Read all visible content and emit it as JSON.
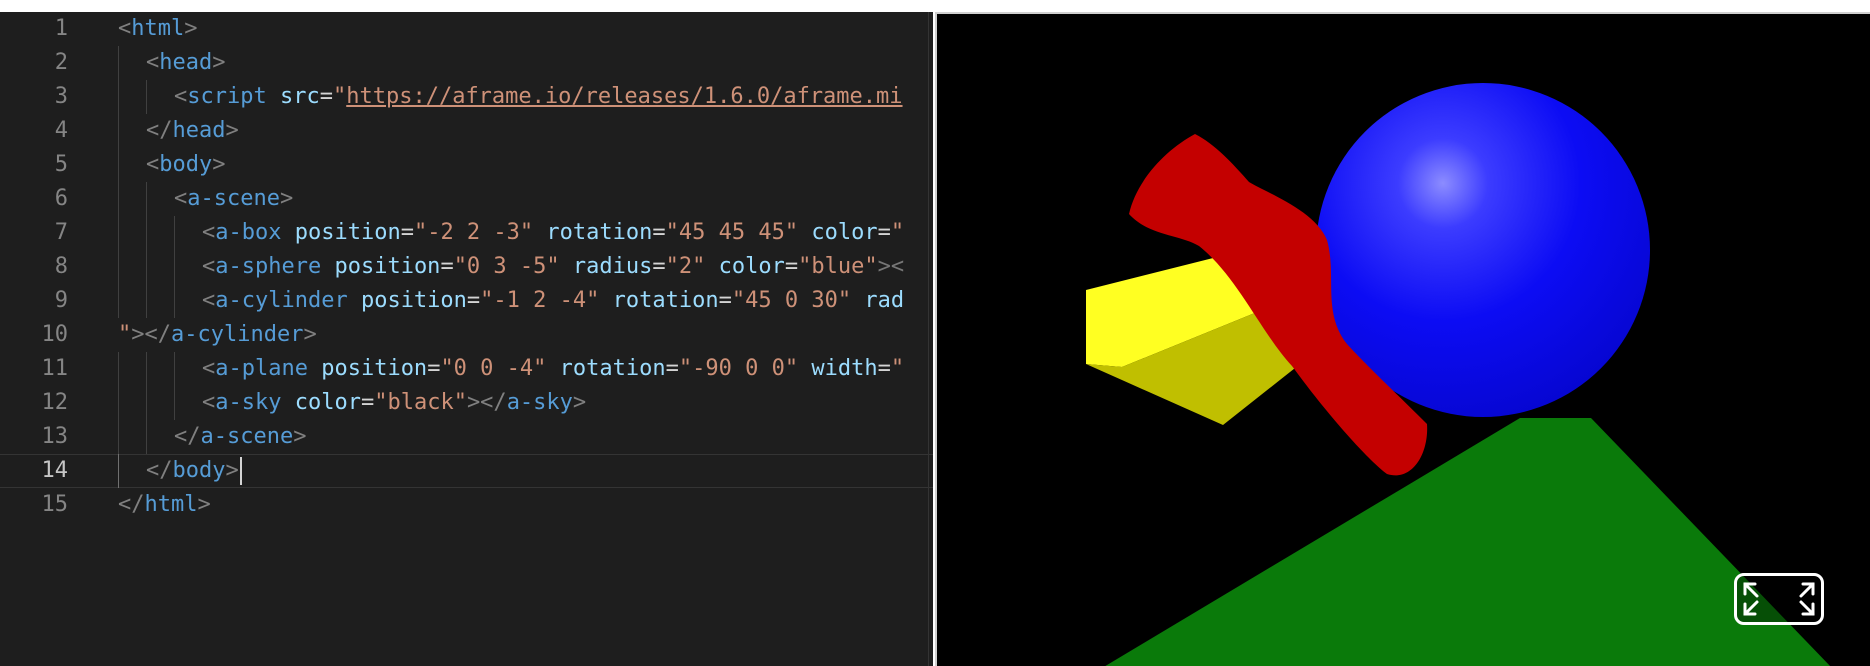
{
  "editor": {
    "current_line": 14,
    "lines": [
      {
        "n": "1",
        "indent": 0,
        "tokens": [
          [
            "punct",
            "<"
          ],
          [
            "tag",
            "html"
          ],
          [
            "punct",
            ">"
          ]
        ]
      },
      {
        "n": "2",
        "indent": 1,
        "tokens": [
          [
            "punct",
            "<"
          ],
          [
            "tag",
            "head"
          ],
          [
            "punct",
            ">"
          ]
        ]
      },
      {
        "n": "3",
        "indent": 2,
        "tokens": [
          [
            "punct",
            "<"
          ],
          [
            "tag",
            "script"
          ],
          [
            "plain",
            " "
          ],
          [
            "attr",
            "src"
          ],
          [
            "eq",
            "="
          ],
          [
            "str",
            "\""
          ],
          [
            "url",
            "https://aframe.io/releases/1.6.0/aframe.mi"
          ]
        ]
      },
      {
        "n": "4",
        "indent": 1,
        "tokens": [
          [
            "punct",
            "</"
          ],
          [
            "tag",
            "head"
          ],
          [
            "punct",
            ">"
          ]
        ]
      },
      {
        "n": "5",
        "indent": 1,
        "tokens": [
          [
            "punct",
            "<"
          ],
          [
            "tag",
            "body"
          ],
          [
            "punct",
            ">"
          ]
        ]
      },
      {
        "n": "6",
        "indent": 2,
        "tokens": [
          [
            "punct",
            "<"
          ],
          [
            "tag",
            "a-scene"
          ],
          [
            "punct",
            ">"
          ]
        ]
      },
      {
        "n": "7",
        "indent": 3,
        "tokens": [
          [
            "punct",
            "<"
          ],
          [
            "tag",
            "a-box"
          ],
          [
            "plain",
            " "
          ],
          [
            "attr",
            "position"
          ],
          [
            "eq",
            "="
          ],
          [
            "str",
            "\"-2 2 -3\""
          ],
          [
            "plain",
            " "
          ],
          [
            "attr",
            "rotation"
          ],
          [
            "eq",
            "="
          ],
          [
            "str",
            "\"45 45 45\""
          ],
          [
            "plain",
            " "
          ],
          [
            "attr",
            "color"
          ],
          [
            "eq",
            "="
          ],
          [
            "str",
            "\""
          ]
        ]
      },
      {
        "n": "8",
        "indent": 3,
        "tokens": [
          [
            "punct",
            "<"
          ],
          [
            "tag",
            "a-sphere"
          ],
          [
            "plain",
            " "
          ],
          [
            "attr",
            "position"
          ],
          [
            "eq",
            "="
          ],
          [
            "str",
            "\"0 3 -5\""
          ],
          [
            "plain",
            " "
          ],
          [
            "attr",
            "radius"
          ],
          [
            "eq",
            "="
          ],
          [
            "str",
            "\"2\""
          ],
          [
            "plain",
            " "
          ],
          [
            "attr",
            "color"
          ],
          [
            "eq",
            "="
          ],
          [
            "str",
            "\"blue\""
          ],
          [
            "fold",
            "><"
          ]
        ]
      },
      {
        "n": "9",
        "indent": 3,
        "tokens": [
          [
            "punct",
            "<"
          ],
          [
            "tag",
            "a-cylinder"
          ],
          [
            "plain",
            " "
          ],
          [
            "attr",
            "position"
          ],
          [
            "eq",
            "="
          ],
          [
            "str",
            "\"-1 2 -4\""
          ],
          [
            "plain",
            " "
          ],
          [
            "attr",
            "rotation"
          ],
          [
            "eq",
            "="
          ],
          [
            "str",
            "\"45 0 30\""
          ],
          [
            "plain",
            " "
          ],
          [
            "attr",
            "rad"
          ]
        ]
      },
      {
        "n": "10",
        "indent": 0,
        "tokens": [
          [
            "str",
            "\""
          ],
          [
            "punct",
            "></"
          ],
          [
            "tag",
            "a-cylinder"
          ],
          [
            "punct",
            ">"
          ]
        ]
      },
      {
        "n": "11",
        "indent": 3,
        "tokens": [
          [
            "punct",
            "<"
          ],
          [
            "tag",
            "a-plane"
          ],
          [
            "plain",
            " "
          ],
          [
            "attr",
            "position"
          ],
          [
            "eq",
            "="
          ],
          [
            "str",
            "\"0 0 -4\""
          ],
          [
            "plain",
            " "
          ],
          [
            "attr",
            "rotation"
          ],
          [
            "eq",
            "="
          ],
          [
            "str",
            "\"-90 0 0\""
          ],
          [
            "plain",
            " "
          ],
          [
            "attr",
            "width"
          ],
          [
            "eq",
            "="
          ],
          [
            "str",
            "\""
          ]
        ]
      },
      {
        "n": "12",
        "indent": 3,
        "tokens": [
          [
            "punct",
            "<"
          ],
          [
            "tag",
            "a-sky"
          ],
          [
            "plain",
            " "
          ],
          [
            "attr",
            "color"
          ],
          [
            "eq",
            "="
          ],
          [
            "str",
            "\"black\""
          ],
          [
            "punct",
            "></"
          ],
          [
            "tag",
            "a-sky"
          ],
          [
            "punct",
            ">"
          ]
        ]
      },
      {
        "n": "13",
        "indent": 2,
        "tokens": [
          [
            "punct",
            "</"
          ],
          [
            "tag",
            "a-scene"
          ],
          [
            "punct",
            ">"
          ]
        ]
      },
      {
        "n": "14",
        "indent": 1,
        "tokens": [
          [
            "punct",
            "</"
          ],
          [
            "tag",
            "body"
          ],
          [
            "punct",
            ">"
          ]
        ]
      },
      {
        "n": "15",
        "indent": 0,
        "tokens": [
          [
            "punct",
            "</"
          ],
          [
            "tag",
            "html"
          ],
          [
            "punct",
            ">"
          ]
        ]
      }
    ]
  },
  "preview": {
    "sky_color": "#000000",
    "plane_color": "#0a7a0a",
    "box_colors": {
      "top": "#ffff22",
      "front": "#c0bf00",
      "side": "#d8d400"
    },
    "sphere_color": "#0a0af2",
    "cylinder_color": "#c40000",
    "fullscreen_icon": "expand-arrows-icon"
  }
}
